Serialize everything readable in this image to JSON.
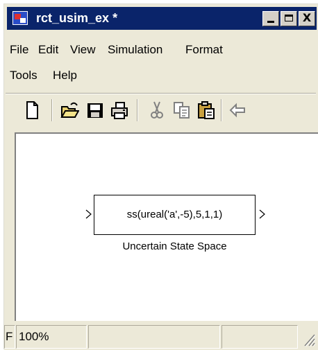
{
  "window": {
    "title": "rct_usim_ex *",
    "controls": {
      "minimize": "minimize",
      "maximize": "maximize",
      "close": "X"
    }
  },
  "menu": {
    "row1": [
      "File",
      "Edit",
      "View",
      "Simulation",
      "Format"
    ],
    "row2": [
      "Tools",
      "Help"
    ]
  },
  "toolbar": {
    "buttons": [
      "new-icon",
      "open-icon",
      "save-icon",
      "print-icon",
      "cut-icon",
      "copy-icon",
      "paste-icon",
      "back-icon"
    ]
  },
  "canvas": {
    "block_expression": "ss(ureal('a',-5),5,1,1)",
    "block_label": "Uncertain State Space"
  },
  "status": {
    "left_text": "F",
    "zoom": "100%",
    "empty_cells": [
      "",
      ""
    ]
  },
  "colors": {
    "titlebar": "#0a246a",
    "window_bg": "#ece9d8"
  }
}
